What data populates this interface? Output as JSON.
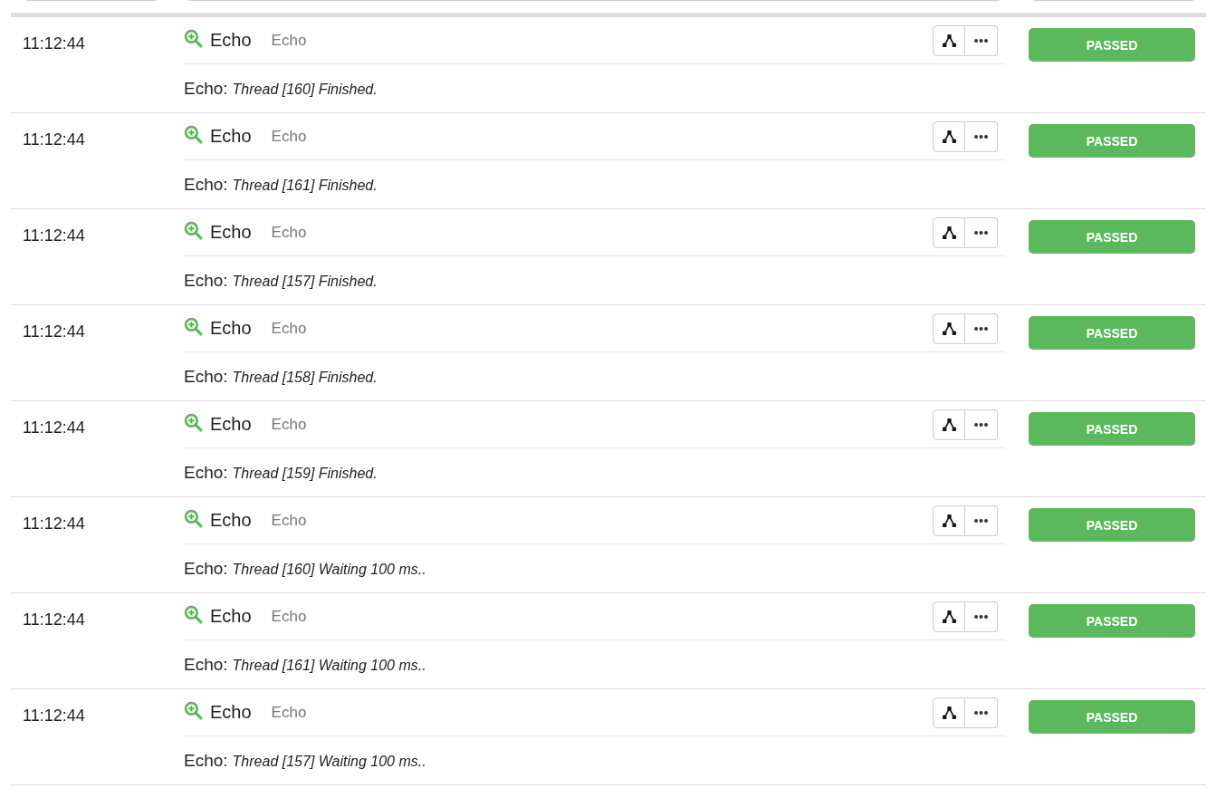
{
  "filter_fields": [
    {
      "kind": "field"
    },
    {
      "kind": "field"
    },
    {
      "kind": "field"
    }
  ],
  "rows": [
    {
      "time": "11:12:44",
      "step_name": "Echo",
      "step_type": "Echo",
      "message_label": "Echo:",
      "message": "Thread [160] Finished.",
      "status": "PASSED",
      "color": "#5cb85c"
    },
    {
      "time": "11:12:44",
      "step_name": "Echo",
      "step_type": "Echo",
      "message_label": "Echo:",
      "message": "Thread [161] Finished.",
      "status": "PASSED",
      "color": "#5cb85c"
    },
    {
      "time": "11:12:44",
      "step_name": "Echo",
      "step_type": "Echo",
      "message_label": "Echo:",
      "message": "Thread [157] Finished.",
      "status": "PASSED",
      "color": "#5cb85c"
    },
    {
      "time": "11:12:44",
      "step_name": "Echo",
      "step_type": "Echo",
      "message_label": "Echo:",
      "message": "Thread [158] Finished.",
      "status": "PASSED",
      "color": "#5cb85c"
    },
    {
      "time": "11:12:44",
      "step_name": "Echo",
      "step_type": "Echo",
      "message_label": "Echo:",
      "message": "Thread [159] Finished.",
      "status": "PASSED",
      "color": "#5cb85c"
    },
    {
      "time": "11:12:44",
      "step_name": "Echo",
      "step_type": "Echo",
      "message_label": "Echo:",
      "message": "Thread [160] Waiting 100 ms..",
      "status": "PASSED",
      "color": "#5cb85c"
    },
    {
      "time": "11:12:44",
      "step_name": "Echo",
      "step_type": "Echo",
      "message_label": "Echo:",
      "message": "Thread [161] Waiting 100 ms..",
      "status": "PASSED",
      "color": "#5cb85c"
    },
    {
      "time": "11:12:44",
      "step_name": "Echo",
      "step_type": "Echo",
      "message_label": "Echo:",
      "message": "Thread [157] Waiting 100 ms..",
      "status": "PASSED",
      "color": "#5cb85c"
    }
  ]
}
